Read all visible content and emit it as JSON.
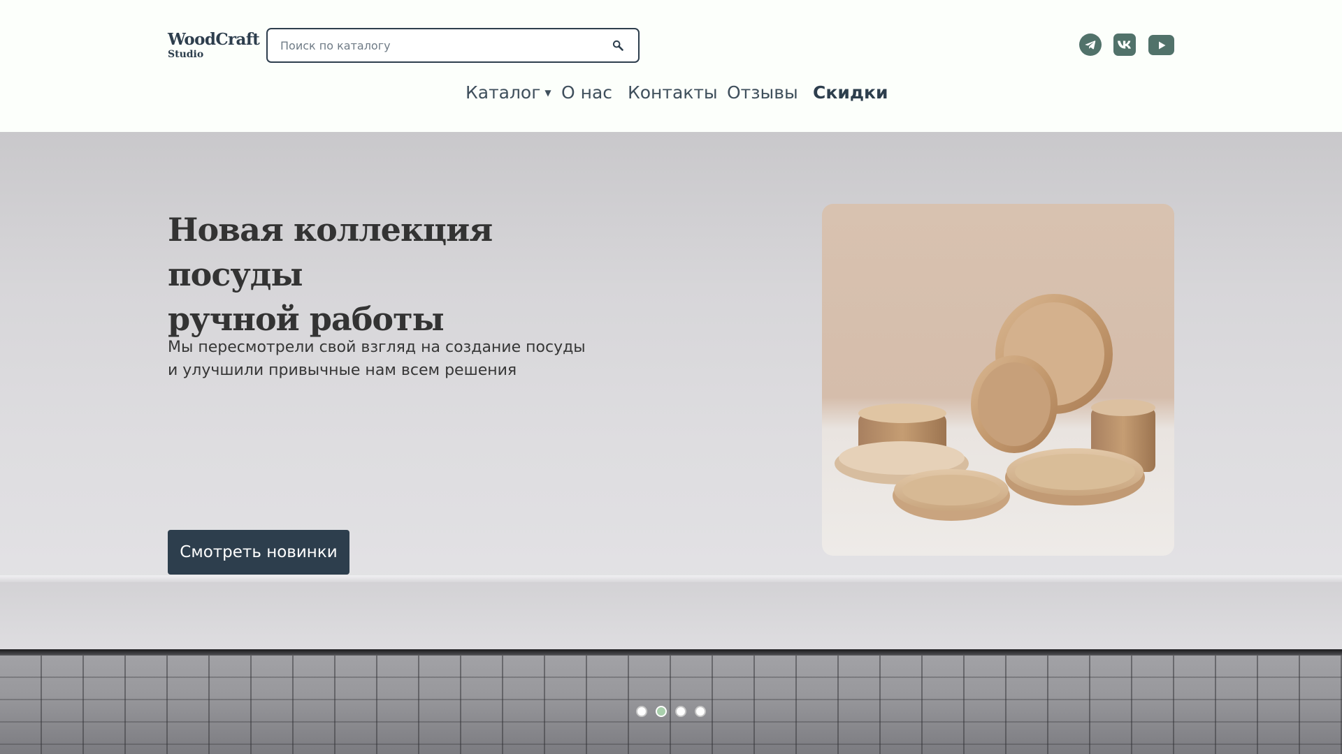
{
  "brand": {
    "name": "WoodCraft",
    "subtitle": "Studio"
  },
  "search": {
    "placeholder": "Поиск по каталогу",
    "value": "",
    "icon": "search-icon"
  },
  "socials": [
    {
      "name": "telegram",
      "icon": "telegram-icon"
    },
    {
      "name": "vk",
      "icon": "vk-icon",
      "text": "VK"
    },
    {
      "name": "youtube",
      "icon": "youtube-icon"
    }
  ],
  "nav": {
    "items": [
      {
        "label": "Каталог",
        "has_dropdown": true
      },
      {
        "label": "О нас"
      },
      {
        "label": "Контакты"
      },
      {
        "label": "Отзывы"
      },
      {
        "label": "Скидки",
        "highlight": true
      }
    ]
  },
  "hero": {
    "title_line1": "Новая коллекция посуды",
    "title_line2": "ручной работы",
    "desc_line1": "Мы пересмотрели свой взгляд на создание посуды",
    "desc_line2": "и улучшили привычные нам всем решения",
    "cta_label": "Смотреть новинки"
  },
  "carousel": {
    "total": 4,
    "active_index": 1
  },
  "colors": {
    "primary": "#2d3e4d",
    "social": "#51726a",
    "active_dot": "#a9cfac"
  }
}
